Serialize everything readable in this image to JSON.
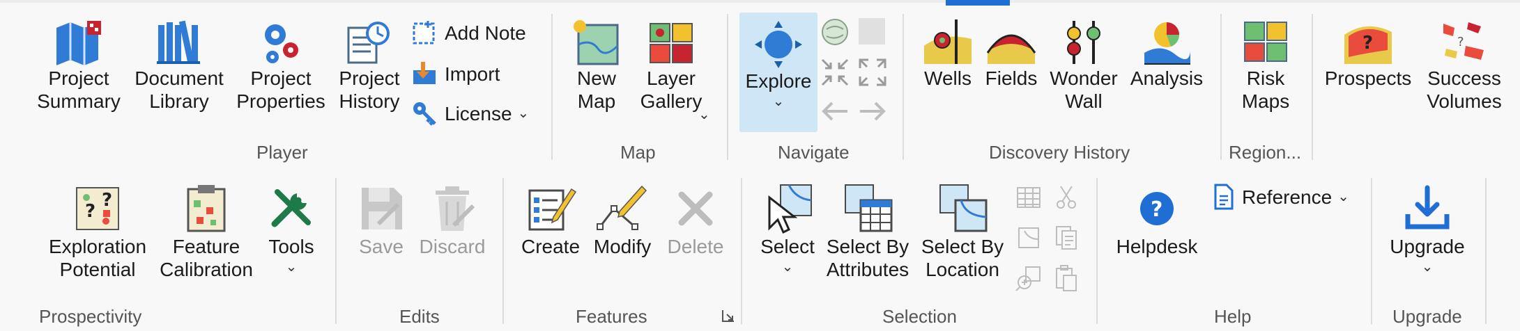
{
  "groups": {
    "player": {
      "label": "Player",
      "project_summary": "Project\nSummary",
      "document_library": "Document\nLibrary",
      "project_properties": "Project\nProperties",
      "project_history": "Project\nHistory",
      "add_note": "Add Note",
      "import": "Import",
      "license": "License"
    },
    "map": {
      "label": "Map",
      "new_map": "New\nMap",
      "layer_gallery": "Layer\nGallery"
    },
    "navigate": {
      "label": "Navigate",
      "explore": "Explore"
    },
    "discovery_history": {
      "label": "Discovery History",
      "wells": "Wells",
      "fields": "Fields",
      "wonder_wall": "Wonder\nWall",
      "analysis": "Analysis"
    },
    "region": {
      "label": "Region...",
      "risk_maps": "Risk\nMaps"
    },
    "region_more": {
      "prospects": "Prospects",
      "success_volumes": "Success\nVolumes"
    },
    "prospectivity": {
      "label": "Prospectivity",
      "exploration_potential": "Exploration\nPotential",
      "feature_calibration": "Feature\nCalibration",
      "tools": "Tools"
    },
    "edits": {
      "label": "Edits",
      "save": "Save",
      "discard": "Discard"
    },
    "features": {
      "label": "Features",
      "create": "Create",
      "modify": "Modify",
      "delete": "Delete"
    },
    "selection": {
      "label": "Selection",
      "select": "Select",
      "select_by_attributes": "Select By\nAttributes",
      "select_by_location": "Select By\nLocation"
    },
    "help": {
      "label": "Help",
      "helpdesk": "Helpdesk",
      "reference": "Reference"
    },
    "upgrade": {
      "label": "Upgrade",
      "upgrade": "Upgrade"
    }
  },
  "caret": "⌄",
  "colors": {
    "accent_blue": "#1f6ed4",
    "explore_highlight": "#cfe6f6",
    "disabled_text": "#9a9a9a"
  },
  "icons": {
    "project_summary": "map-folded-icon",
    "document_library": "books-icon",
    "project_properties": "gears-icon",
    "project_history": "history-clock-icon",
    "add_note": "sticky-note-icon",
    "import": "import-icon",
    "license": "key-icon",
    "new_map": "new-map-icon",
    "layer_gallery": "layer-gallery-icon",
    "explore": "explore-navigation-icon",
    "wells": "wells-icon",
    "fields": "fields-icon",
    "wonder_wall": "wonder-wall-icon",
    "analysis": "analysis-icon",
    "risk_maps": "risk-maps-icon",
    "prospects": "prospects-icon",
    "success_volumes": "success-volumes-icon",
    "exploration_potential": "exploration-potential-icon",
    "feature_calibration": "feature-calibration-icon",
    "tools": "tools-icon",
    "save": "save-disk-icon",
    "discard": "trash-icon",
    "create": "create-checklist-icon",
    "modify": "modify-pencil-icon",
    "delete": "delete-x-icon",
    "select": "select-cursor-icon",
    "select_by_attributes": "select-attributes-icon",
    "select_by_location": "select-location-icon",
    "helpdesk": "help-circle-icon",
    "reference": "document-icon",
    "upgrade": "download-icon"
  }
}
